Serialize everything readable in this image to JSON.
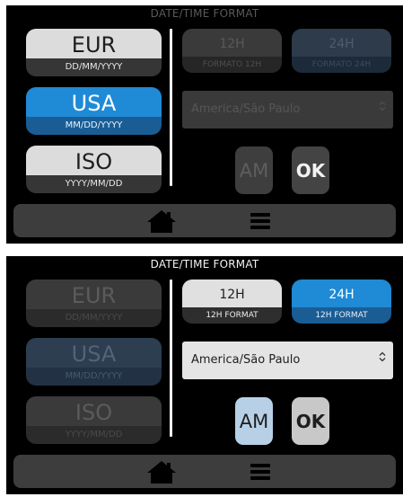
{
  "panels": [
    {
      "title": "DATE/TIME FORMAT",
      "formats": [
        {
          "label": "EUR",
          "pattern": "DD/MM/YYYY"
        },
        {
          "label": "USA",
          "pattern": "MM/DD/YYYY"
        },
        {
          "label": "ISO",
          "pattern": "YYYY/MM/DD"
        }
      ],
      "selected_format": "USA",
      "hour12": {
        "label": "12H",
        "sub": "FORMATO 12H"
      },
      "hour24": {
        "label": "24H",
        "sub": "FORMATO 24H"
      },
      "timezone": "America/São Paulo",
      "ampm": "AM",
      "ok": "OK",
      "state": "date-format-editing"
    },
    {
      "title": "DATE/TIME FORMAT",
      "formats": [
        {
          "label": "EUR",
          "pattern": "DD/MM/YYYY"
        },
        {
          "label": "USA",
          "pattern": "MM/DD/YYYY"
        },
        {
          "label": "ISO",
          "pattern": "YYYY/MM/DD"
        }
      ],
      "selected_format": "USA",
      "hour12": {
        "label": "12H",
        "sub": "12H FORMAT"
      },
      "hour24": {
        "label": "24H",
        "sub": "12H FORMAT"
      },
      "timezone": "America/São Paulo",
      "ampm": "AM",
      "ok": "OK",
      "state": "time-format-editing"
    }
  ],
  "icons": {
    "home": "home-icon",
    "menu": "hamburger-menu-icon",
    "dropdown": "chevron-updown-icon"
  },
  "colors": {
    "accent_blue": "#1f8ad6",
    "accent_blue_dark": "#1a5d95",
    "background": "#000000",
    "navbar": "#3d3d3d"
  }
}
